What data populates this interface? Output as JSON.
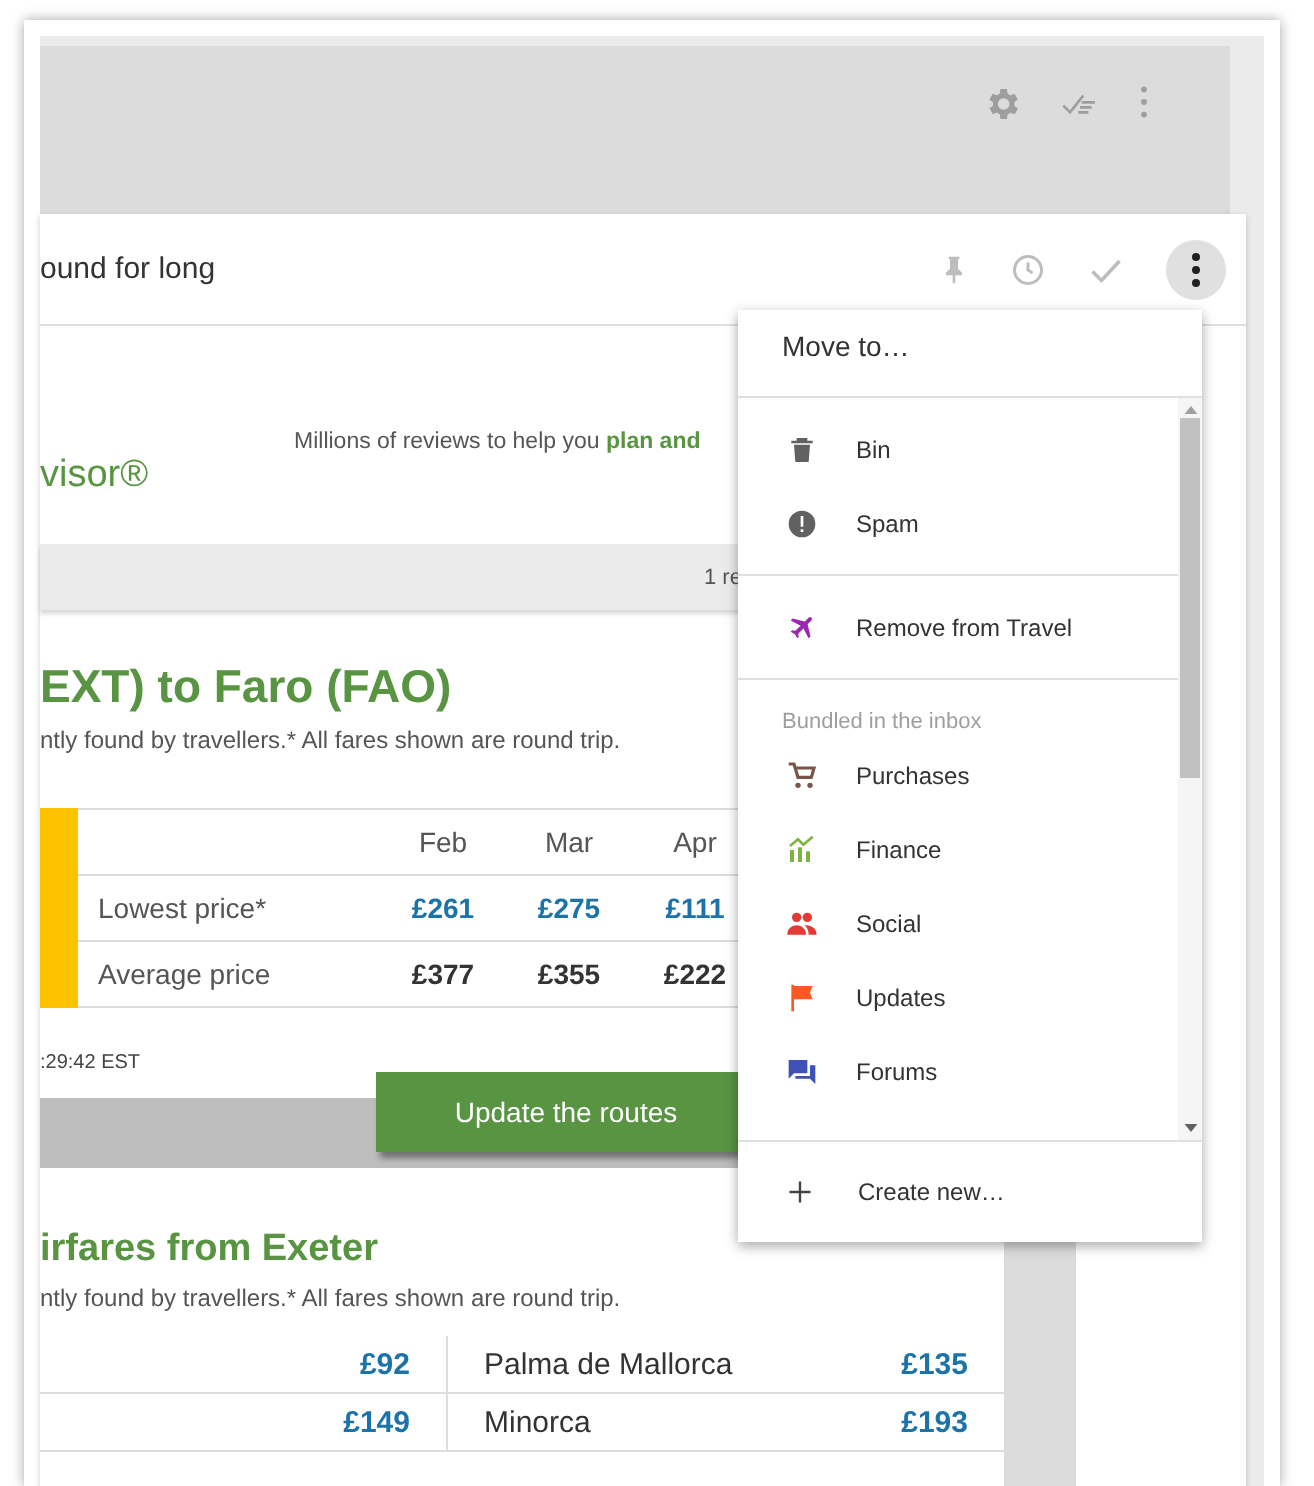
{
  "subject": "ound for long",
  "email": {
    "logo": "visor®",
    "tagline": "Millions of reviews to help you **plan and**",
    "notice": "1 re",
    "route_heading": "EXT) to Faro (FAO)",
    "route_note": "ntly found by travellers.* All fares shown are round trip.",
    "price_table": {
      "columns": [
        "Feb",
        "Mar",
        "Apr"
      ],
      "rows": [
        {
          "label": "Lowest price*",
          "kind": "lowest",
          "values": [
            "£261",
            "£275",
            "£111"
          ]
        },
        {
          "label": "Average price",
          "kind": "average",
          "values": [
            "£377",
            "£355",
            "£222"
          ]
        }
      ]
    },
    "timestamp": ":29:42 EST",
    "update_button": "Update the routes",
    "fares_heading": "irfares from Exeter",
    "fares_note": "ntly found by travellers.* All fares shown are round trip.",
    "fares": [
      {
        "left_price": "£92",
        "right_place": "Palma de Mallorca",
        "right_price": "£135"
      },
      {
        "left_price": "£149",
        "right_place": "Minorca",
        "right_price": "£193"
      }
    ]
  },
  "menu": {
    "title": "Move to…",
    "items": [
      {
        "kind": "action",
        "label": "Bin"
      },
      {
        "kind": "action",
        "label": "Spam"
      },
      {
        "kind": "divider"
      },
      {
        "kind": "action",
        "label": "Remove from Travel",
        "color": "#9c27b0"
      },
      {
        "kind": "divider"
      },
      {
        "kind": "heading",
        "label": "Bundled in the inbox"
      },
      {
        "kind": "action",
        "label": "Purchases",
        "color": "#795548"
      },
      {
        "kind": "action",
        "label": "Finance",
        "color": "#7cb342"
      },
      {
        "kind": "action",
        "label": "Social",
        "color": "#e53935"
      },
      {
        "kind": "action",
        "label": "Updates",
        "color": "#ff5722"
      },
      {
        "kind": "action",
        "label": "Forums",
        "color": "#3f51b5"
      }
    ],
    "footer": "Create new…"
  }
}
